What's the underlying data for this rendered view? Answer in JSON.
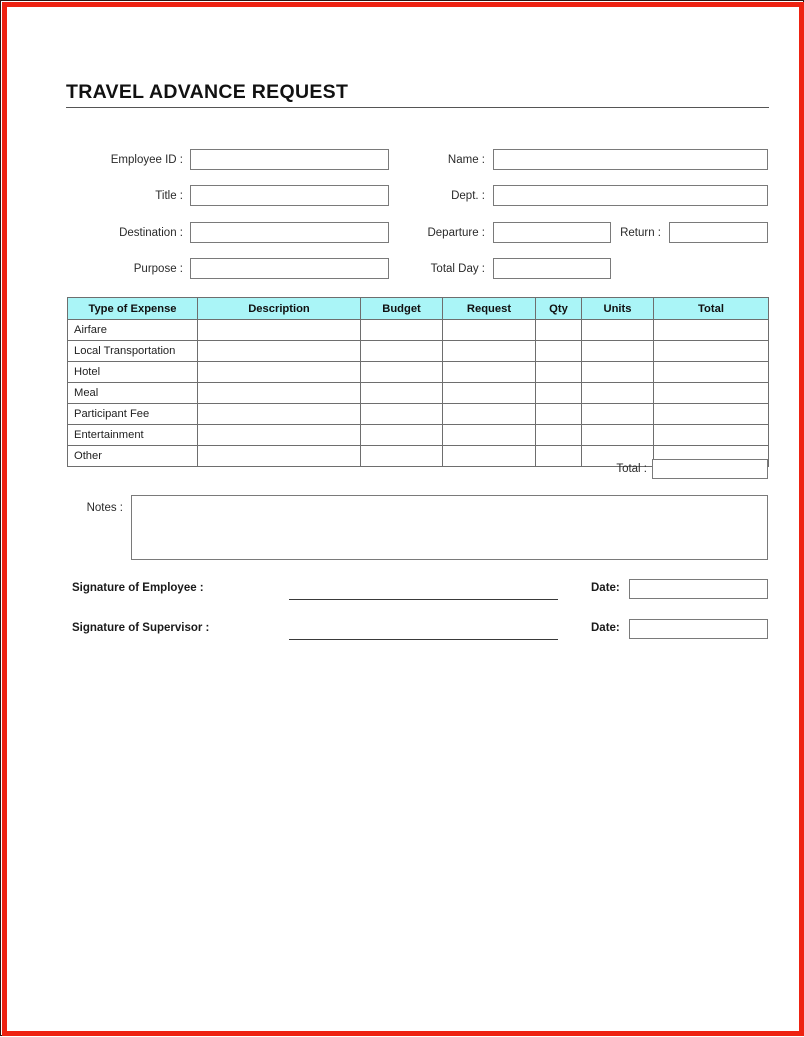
{
  "document": {
    "title": "TRAVEL ADVANCE REQUEST"
  },
  "form_fields": {
    "employee_id": {
      "label": "Employee ID :",
      "value": ""
    },
    "name": {
      "label": "Name :",
      "value": ""
    },
    "title": {
      "label": "Title :",
      "value": ""
    },
    "dept": {
      "label": "Dept. :",
      "value": ""
    },
    "destination": {
      "label": "Destination :",
      "value": ""
    },
    "departure": {
      "label": "Departure :",
      "value": ""
    },
    "return": {
      "label": "Return :",
      "value": ""
    },
    "purpose": {
      "label": "Purpose :",
      "value": ""
    },
    "total_day": {
      "label": "Total Day :",
      "value": ""
    }
  },
  "expense_table": {
    "headers": [
      "Type of Expense",
      "Description",
      "Budget",
      "Request",
      "Qty",
      "Units",
      "Total"
    ],
    "rows": [
      {
        "type": "Airfare",
        "description": "",
        "budget": "",
        "request": "",
        "qty": "",
        "units": "",
        "total": ""
      },
      {
        "type": "Local Transportation",
        "description": "",
        "budget": "",
        "request": "",
        "qty": "",
        "units": "",
        "total": ""
      },
      {
        "type": "Hotel",
        "description": "",
        "budget": "",
        "request": "",
        "qty": "",
        "units": "",
        "total": ""
      },
      {
        "type": "Meal",
        "description": "",
        "budget": "",
        "request": "",
        "qty": "",
        "units": "",
        "total": ""
      },
      {
        "type": "Participant Fee",
        "description": "",
        "budget": "",
        "request": "",
        "qty": "",
        "units": "",
        "total": ""
      },
      {
        "type": "Entertainment",
        "description": "",
        "budget": "",
        "request": "",
        "qty": "",
        "units": "",
        "total": ""
      },
      {
        "type": "Other",
        "description": "",
        "budget": "",
        "request": "",
        "qty": "",
        "units": "",
        "total": ""
      }
    ],
    "header_background": "#aaf5f7",
    "grand_total": {
      "label": "Total :",
      "value": ""
    }
  },
  "notes": {
    "label": "Notes :",
    "value": ""
  },
  "signatures": {
    "employee": {
      "label": "Signature of Employee :",
      "date_label": "Date:",
      "date_value": ""
    },
    "supervisor": {
      "label": "Signature of Supervisor :",
      "date_label": "Date:",
      "date_value": ""
    }
  },
  "style": {
    "border_outer": "#2b1410",
    "border_accent": "#ee2211",
    "field_border": "#7a7a7a"
  }
}
